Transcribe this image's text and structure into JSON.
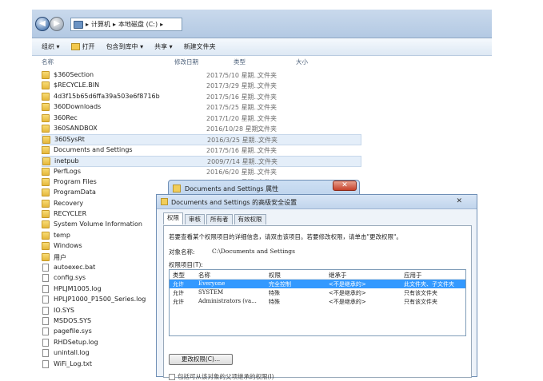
{
  "explorer": {
    "breadcrumb": [
      "计算机",
      "本地磁盘 (C:)"
    ],
    "toolbar": [
      "组织 ▾",
      "打开",
      "包含到库中 ▾",
      "共享 ▾",
      "新建文件夹"
    ],
    "columns": [
      "名称",
      "修改日期",
      "类型",
      "大小"
    ],
    "files": [
      {
        "name": "$360Section",
        "date": "2017/5/10 星期...",
        "type": "文件夹",
        "kind": "folder"
      },
      {
        "name": "$RECYCLE.BIN",
        "date": "2017/3/29 星期...",
        "type": "文件夹",
        "kind": "folder"
      },
      {
        "name": "4d3f15b65d6ffa39a503e6f8716b",
        "date": "2017/5/16 星期...",
        "type": "文件夹",
        "kind": "folder"
      },
      {
        "name": "360Downloads",
        "date": "2017/5/25 星期...",
        "type": "文件夹",
        "kind": "folder"
      },
      {
        "name": "360Rec",
        "date": "2017/1/20 星期...",
        "type": "文件夹",
        "kind": "folder"
      },
      {
        "name": "360SANDBOX",
        "date": "2016/10/28 星期...",
        "type": "文件夹",
        "kind": "folder"
      },
      {
        "name": "360SysRt",
        "date": "2016/3/25 星期...",
        "type": "文件夹",
        "kind": "folder",
        "selected": true
      },
      {
        "name": "Documents and Settings",
        "date": "2017/5/16 星期...",
        "type": "文件夹",
        "kind": "link"
      },
      {
        "name": "inetpub",
        "date": "2009/7/14 星期...",
        "type": "文件夹",
        "kind": "folder",
        "selected": true
      },
      {
        "name": "PerfLogs",
        "date": "2016/6/20 星期...",
        "type": "文件夹",
        "kind": "folder"
      },
      {
        "name": "Program Files",
        "date": "2009/7/14 星期...",
        "type": "文件夹",
        "kind": "folder"
      },
      {
        "name": "ProgramData",
        "date": "",
        "type": "",
        "kind": "folder"
      },
      {
        "name": "Recovery",
        "date": "",
        "type": "",
        "kind": "folder"
      },
      {
        "name": "RECYCLER",
        "date": "",
        "type": "",
        "kind": "folder"
      },
      {
        "name": "System Volume Information",
        "date": "",
        "type": "",
        "kind": "folder"
      },
      {
        "name": "temp",
        "date": "",
        "type": "",
        "kind": "folder"
      },
      {
        "name": "Windows",
        "date": "",
        "type": "",
        "kind": "folder"
      },
      {
        "name": "用户",
        "date": "",
        "type": "",
        "kind": "folder"
      },
      {
        "name": "autoexec.bat",
        "date": "",
        "type": "",
        "kind": "file"
      },
      {
        "name": "config.sys",
        "date": "",
        "type": "",
        "kind": "file"
      },
      {
        "name": "HPLJM1005.log",
        "date": "",
        "type": "",
        "kind": "file"
      },
      {
        "name": "HPLJP1000_P1500_Series.log",
        "date": "",
        "type": "",
        "kind": "file"
      },
      {
        "name": "IO.SYS",
        "date": "",
        "type": "",
        "kind": "file"
      },
      {
        "name": "MSDOS.SYS",
        "date": "",
        "type": "",
        "kind": "file"
      },
      {
        "name": "pagefile.sys",
        "date": "",
        "type": "",
        "kind": "file"
      },
      {
        "name": "RHDSetup.log",
        "date": "",
        "type": "",
        "kind": "file"
      },
      {
        "name": "unintall.log",
        "date": "",
        "type": "",
        "kind": "file"
      },
      {
        "name": "WiFi_Log.txt",
        "date": "",
        "type": "",
        "kind": "file"
      }
    ]
  },
  "props_dialog": {
    "title": "Documents and Settings 属性",
    "close": "✕"
  },
  "advanced_dialog": {
    "title": "Documents and Settings 的高级安全设置",
    "close": "✕",
    "tabs": [
      "权限",
      "审核",
      "所有者",
      "有效权限"
    ],
    "intro": "若要查看某个权限项目的详细信息，请双击该项目。若要修改权限，请单击\"更改权限\"。",
    "object_label": "对象名称:",
    "object_value": "C:\\Documents and Settings",
    "entries_label": "权限项目(T):",
    "list_columns": [
      "类型",
      "名称",
      "权限",
      "继承于",
      "应用于"
    ],
    "entries": [
      {
        "type": "允许",
        "name": "Everyone",
        "perm": "完全控制",
        "from": "<不是继承的>",
        "apply": "此文件夹、子文件夹",
        "selected": true
      },
      {
        "type": "允许",
        "name": "SYSTEM",
        "perm": "特殊",
        "from": "<不是继承的>",
        "apply": "只有该文件夹"
      },
      {
        "type": "允许",
        "name": "Administrators (va...",
        "perm": "特殊",
        "from": "<不是继承的>",
        "apply": "只有该文件夹"
      }
    ],
    "change_button": "更改权限(C)...",
    "inherit_label": "包括可从该对象的父项继承的权限(I)"
  }
}
